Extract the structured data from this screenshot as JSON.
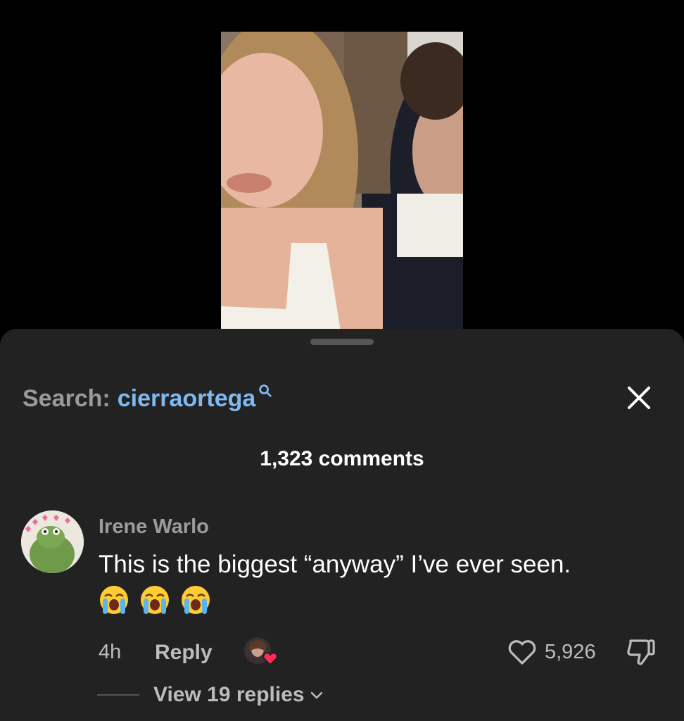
{
  "search": {
    "prefix": "Search:",
    "term": "cierraortega"
  },
  "comments_count": "1,323 comments",
  "comment": {
    "author": "Irene Warlo",
    "text": "This is the biggest “anyway” I’ve ever seen.",
    "emojis": [
      "loudly-crying-face",
      "loudly-crying-face",
      "loudly-crying-face"
    ],
    "time": "4h",
    "reply_label": "Reply",
    "likes": "5,926",
    "view_replies": "View 19 replies"
  },
  "colors": {
    "sheet_bg": "#222222",
    "search_term": "#7fb8ef",
    "heart_red": "#ff2d55"
  }
}
